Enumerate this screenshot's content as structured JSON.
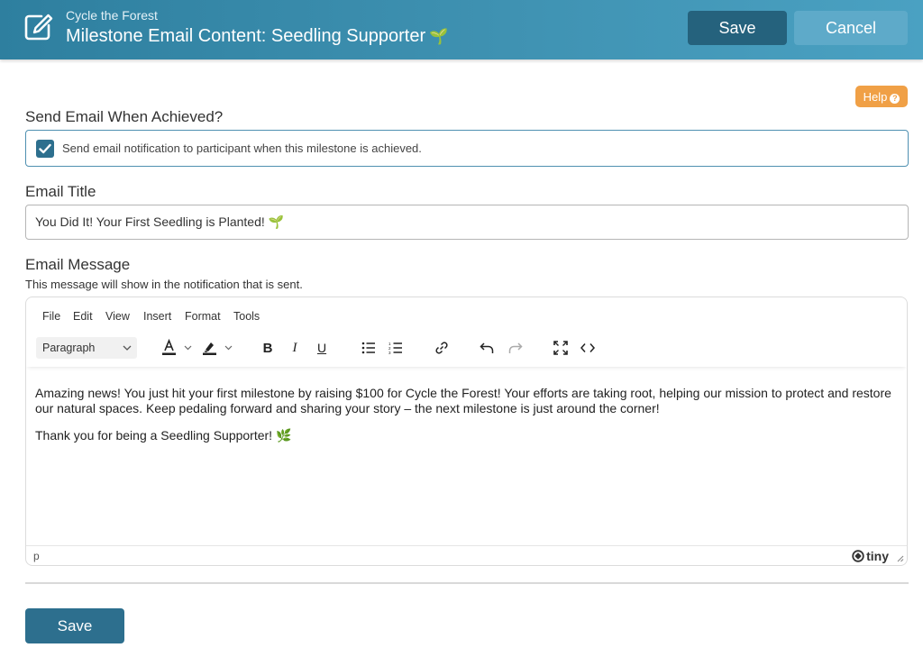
{
  "header": {
    "org_name": "Cycle the Forest",
    "title": "Milestone Email Content: Seedling Supporter",
    "title_emoji": "🌱",
    "save_label": "Save",
    "cancel_label": "Cancel",
    "icon": "edit-icon"
  },
  "help": {
    "label": "Help",
    "icon": "question-circle-icon"
  },
  "send_email": {
    "label": "Send Email When Achieved?",
    "checked": true,
    "checkbox_text": "Send email notification to participant when this milestone is achieved."
  },
  "email_title": {
    "label": "Email Title",
    "value": "You Did It! Your First Seedling is Planted! 🌱"
  },
  "email_message": {
    "label": "Email Message",
    "description": "This message will show in the notification that is sent."
  },
  "editor": {
    "menu": [
      "File",
      "Edit",
      "View",
      "Insert",
      "Format",
      "Tools"
    ],
    "block_format": "Paragraph",
    "paragraphs": [
      "Amazing news! You just hit your first milestone by raising $100 for Cycle the Forest! Your efforts are taking root, helping our mission to protect and restore our natural spaces. Keep pedaling forward and sharing your story – the next milestone is just around the corner!",
      "Thank you for being a Seedling Supporter! 🌿"
    ],
    "status_path": "p",
    "brand": "tiny"
  },
  "footer": {
    "save_label": "Save"
  },
  "colors": {
    "header_bg": "#3a8fb0",
    "primary_button": "#2d6f8e",
    "cancel_button": "#5eaac9",
    "help_button": "#f0a046",
    "checkbox_border": "#4f90b1"
  }
}
